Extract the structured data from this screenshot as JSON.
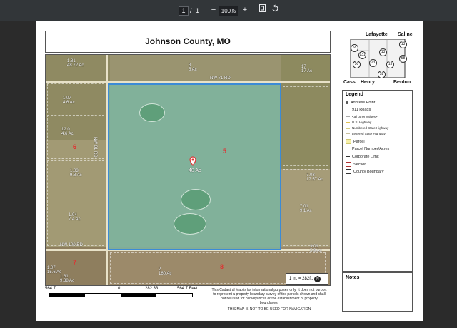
{
  "viewer": {
    "page_current": "1",
    "page_sep": "/",
    "page_total": "1",
    "zoom_out": "−",
    "zoom_level": "100%",
    "zoom_in": "+"
  },
  "map": {
    "title": "Johnson County, MO",
    "roads": {
      "top": "NW 71 RD",
      "left": "NW 81 RD",
      "bottom": "NW 100 RD"
    },
    "sections": [
      "6",
      "5",
      "7",
      "8"
    ],
    "subject_acres": "40 Ac",
    "parcels": [
      {
        "id": "1.81",
        "acres": "48.72 Ac"
      },
      {
        "id": "3",
        "acres": "5 Ac"
      },
      {
        "id": "17",
        "acres": "17 Ac"
      },
      {
        "id": "1.07",
        "acres": "4.6 Ac"
      },
      {
        "id": "12.0",
        "acres": "4.6 Ac"
      },
      {
        "id": "1.03",
        "acres": "9.8 Ac"
      },
      {
        "id": "7.01",
        "acres": "9.1 Ac"
      },
      {
        "id": "1.04",
        "acres": "7.4 Ac"
      },
      {
        "id": "2",
        "acres": "160 Ac"
      },
      {
        "id": "1.07",
        "acres": "15.6 Ac"
      },
      {
        "id": "1.81",
        "acres": "9.38 Ac"
      },
      {
        "id": "7.03",
        "acres": "17.57 Ac"
      },
      {
        "id": "3.01",
        "acres": "5.9 Ac"
      }
    ],
    "scale_note": "1 in. = 282ft.",
    "north_label": "N"
  },
  "inset": {
    "counties": [
      "Lafayette",
      "Saline",
      "Cass",
      "Henry",
      "Benton"
    ],
    "highways": [
      "58",
      "131",
      "13",
      "13",
      "58",
      "50",
      "23",
      "13",
      "52"
    ]
  },
  "legend": {
    "title": "Legend",
    "items": [
      "Address Point",
      "911 Roads",
      "<all other values>",
      "U.S. Highway",
      "Numbered State Highway",
      "Lettered State Highway",
      "Parcel",
      "Parcel Number/Acres",
      "Corporate Limit",
      "Section",
      "County Boundary"
    ]
  },
  "notes": {
    "title": "Notes"
  },
  "scalebar": {
    "left": "564.7",
    "zero": "0",
    "mid": "282.33",
    "right": "564.7 Feet"
  },
  "disclaimer": {
    "text": "This Cadastral Map is for informational purposes only. It does not purport to represent a property boundary survey of the parcels shown and shall not be used for conveyances or the establishment of property boundaries.",
    "warning": "THIS MAP IS NOT TO BE USED FOR NAVIGATION"
  }
}
